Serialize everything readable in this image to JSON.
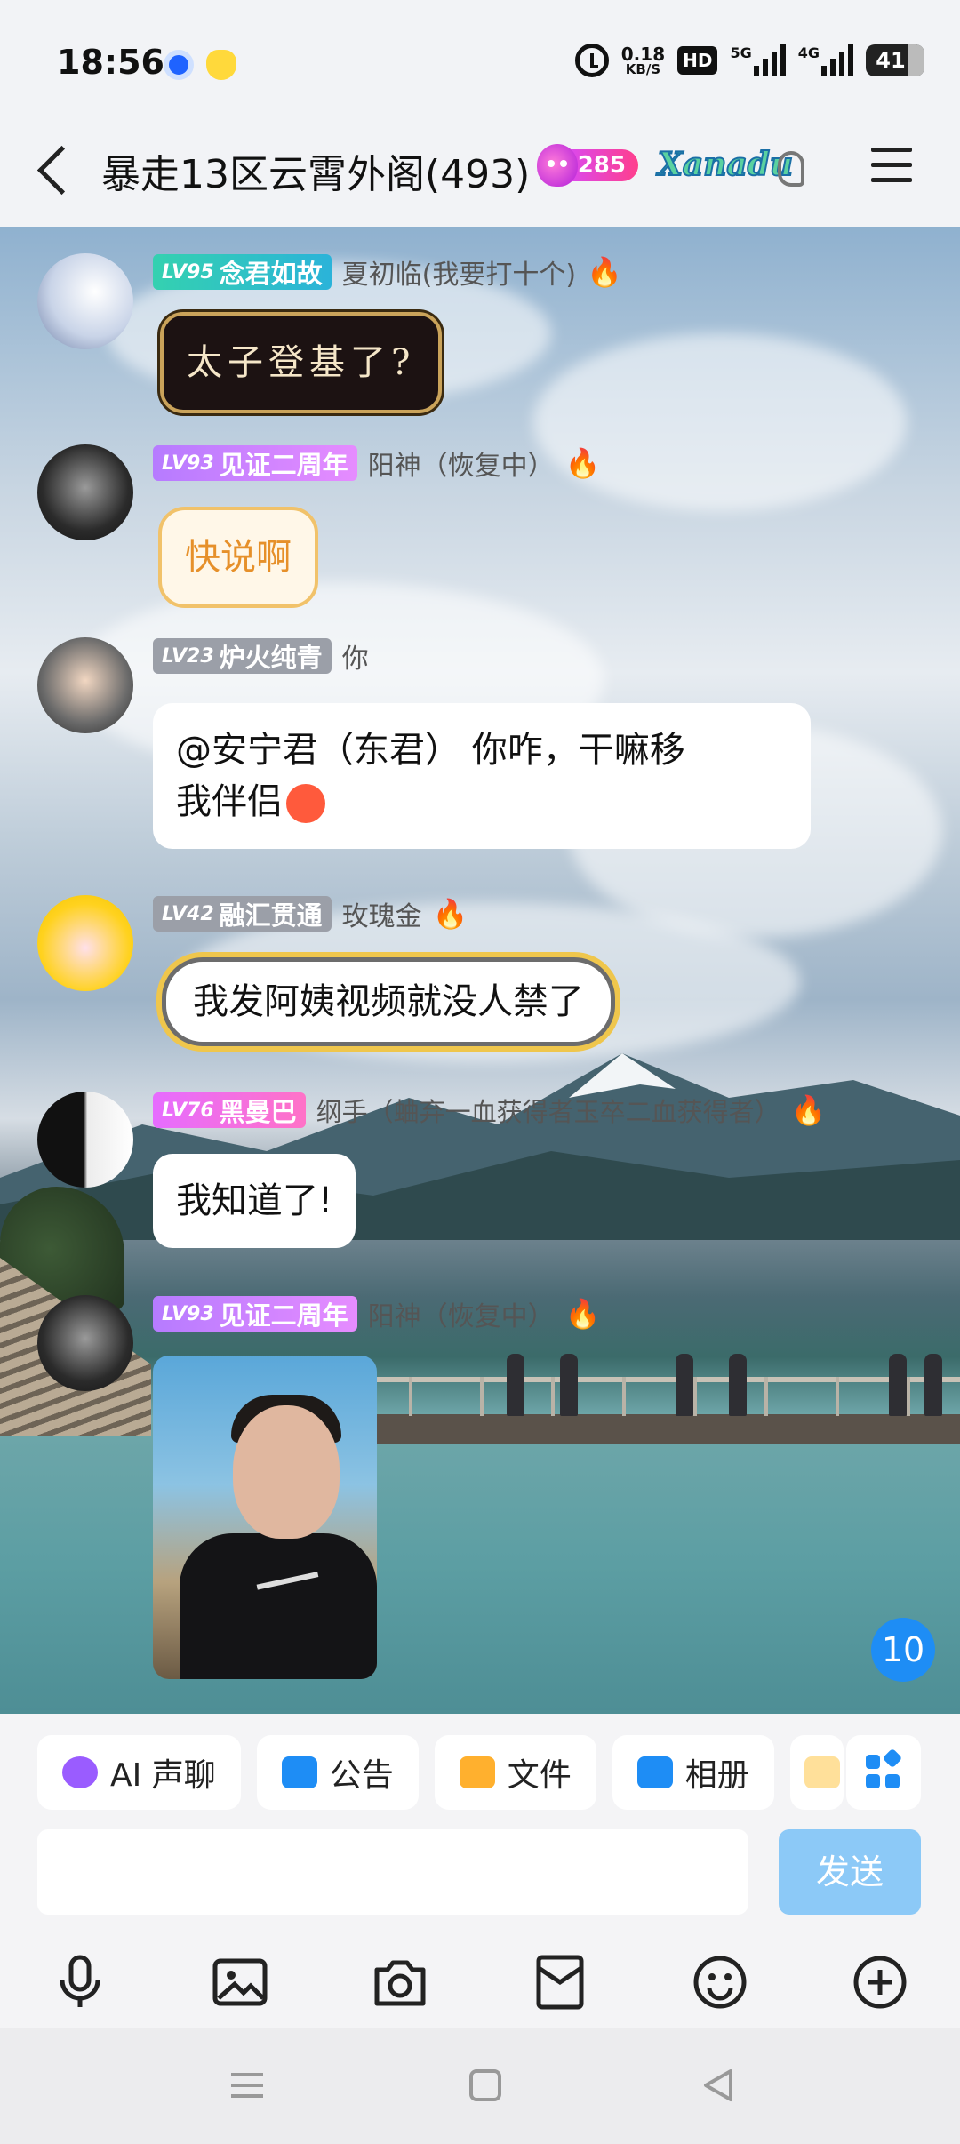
{
  "status_bar": {
    "time": "18:56",
    "net_speed_value": "0.18",
    "net_speed_unit": "KB/S",
    "hd_label": "HD",
    "sim1_label": "5G",
    "sim2_label": "4G",
    "battery": "41"
  },
  "header": {
    "title": "暴走13区云霄外阁(493)",
    "fire_count": "285",
    "brand_badge": "Xanadu"
  },
  "messages": [
    {
      "level": "LV95",
      "title": "念君如故",
      "nickname": "夏初临(我要打十个)",
      "text": "太子登基了?"
    },
    {
      "level": "LV93",
      "title": "见证二周年",
      "nickname": "阳神（恢复中）",
      "text": "快说啊"
    },
    {
      "level": "LV23",
      "title": "炉火纯青",
      "nickname": "你",
      "text_line1": "@安宁君（东君） 你咋，干嘛移",
      "text_line2": "我伴侣"
    },
    {
      "level": "LV42",
      "title": "融汇贯通",
      "nickname": "玫瑰金",
      "text": "我发阿姨视频就没人禁了"
    },
    {
      "level": "LV76",
      "title": "黑曼巴",
      "nickname": "纲手（蛐弃一血获得者玉卒二血获得者）",
      "text": "我知道了!"
    },
    {
      "level": "LV93",
      "title": "见证二周年",
      "nickname": "阳神（恢复中）",
      "image": "photo"
    }
  ],
  "unread_count": "10",
  "quick_actions": [
    {
      "label": "AI 声聊",
      "icon": "ai-voice-icon"
    },
    {
      "label": "公告",
      "icon": "announcement-icon"
    },
    {
      "label": "文件",
      "icon": "folder-icon"
    },
    {
      "label": "相册",
      "icon": "album-icon"
    }
  ],
  "composer": {
    "placeholder": "",
    "send_label": "发送"
  },
  "toolbar_icons": [
    "microphone-icon",
    "image-icon",
    "camera-icon",
    "red-packet-icon",
    "emoji-icon",
    "plus-icon"
  ],
  "colors": {
    "accent": "#1e8df5",
    "send_disabled": "#8cc9f7"
  }
}
